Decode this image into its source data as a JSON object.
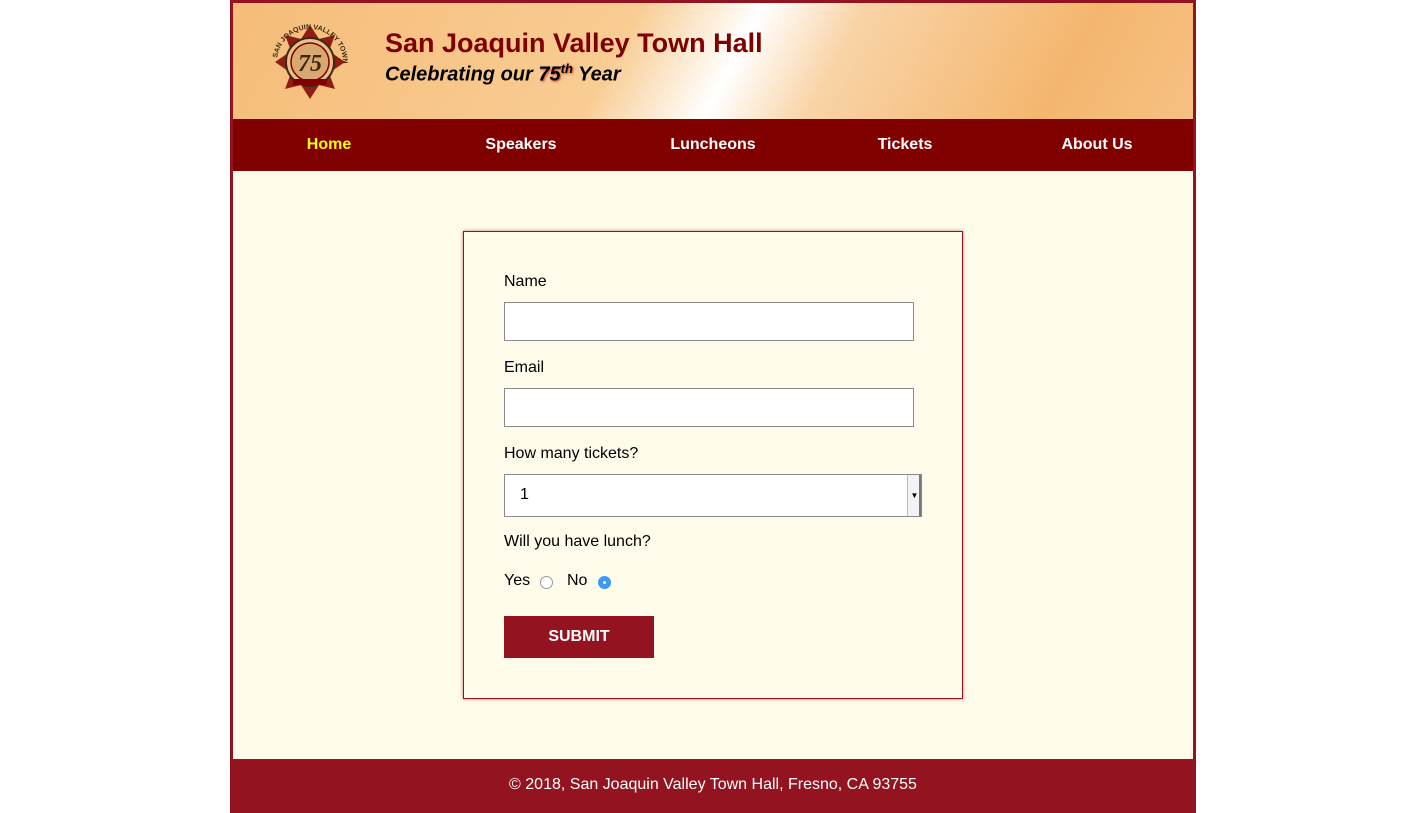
{
  "header": {
    "title": "San Joaquin Valley Town Hall",
    "tagline_prefix": "Celebrating our ",
    "tagline_number": "75",
    "tagline_sup": "th",
    "tagline_suffix": " Year",
    "logo": {
      "icon": "seal-icon",
      "number": "75",
      "ring_text": "SAN JOAQUIN VALLEY TOWN HALL",
      "colors": [
        "#7e0000",
        "#3a2a10",
        "#e7c08a"
      ]
    }
  },
  "nav": {
    "items": [
      {
        "label": "Home",
        "active": true
      },
      {
        "label": "Speakers"
      },
      {
        "label": "Luncheons"
      },
      {
        "label": "Tickets"
      },
      {
        "label": "About Us"
      }
    ]
  },
  "form": {
    "name_label": "Name",
    "name_value": "",
    "email_label": "Email",
    "email_value": "",
    "tickets_label": "How many tickets?",
    "tickets_selected": "1",
    "lunch_label": "Will you have lunch?",
    "lunch_yes_label": "Yes",
    "lunch_no_label": "No",
    "lunch_selected": "No",
    "submit_label": "SUBMIT"
  },
  "footer": {
    "text": "© 2018, San Joaquin Valley Town Hall, Fresno, CA 93755"
  },
  "colors": {
    "brand_dark": "#800000",
    "brand": "#931420",
    "nav_active": "#ffff00",
    "content_bg": "#fffbea",
    "radio_checked": "#3b99fc"
  }
}
